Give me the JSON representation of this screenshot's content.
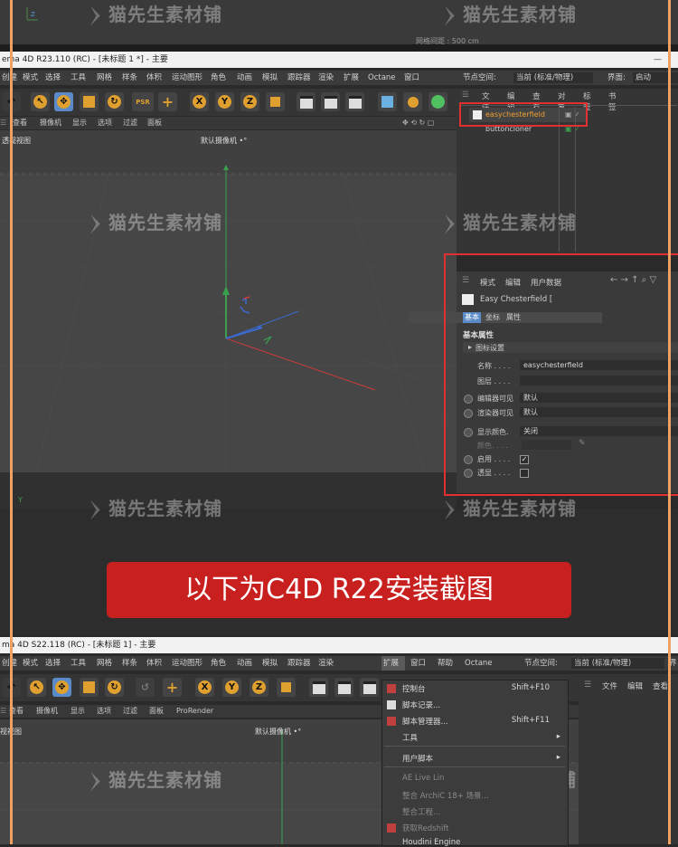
{
  "top_section": {
    "grid_label": "网格间距 : 500 cm"
  },
  "r23": {
    "title": "ema 4D R23.110 (RC) - [未标题 1 *] - 主要",
    "menu": [
      "创建",
      "模式",
      "选择",
      "工具",
      "网格",
      "样条",
      "体积",
      "运动图形",
      "角色",
      "动画",
      "模拟",
      "跟踪器",
      "渲染",
      "扩展",
      "Octane",
      "窗口"
    ],
    "node_space_label": "节点空间:",
    "node_space_value": "当前 (标准/物理)",
    "interface_label": "界面:",
    "interface_value": "启动",
    "toolbar_xyz": [
      "X",
      "Y",
      "Z"
    ],
    "view_menu": [
      "查看",
      "摄像机",
      "显示",
      "选项",
      "过滤",
      "面板"
    ],
    "viewport_name": "透视视图",
    "camera_label": "默认摄像机 •°",
    "obj_menu": [
      "文件",
      "编辑",
      "查看",
      "对象",
      "标签",
      "书签"
    ],
    "objects": [
      {
        "name": "easychesterfield"
      },
      {
        "name": "buttoncloner"
      }
    ],
    "attr_menu": [
      "模式",
      "编辑",
      "用户数据"
    ],
    "attr_object": "Easy Chesterfield [",
    "attr_tabs": [
      "基本",
      "坐标",
      "属性"
    ],
    "attr_section": "基本属性",
    "attr_group": "图标设置",
    "props": {
      "name_label": "名称 . . . .",
      "name_value": "easychesterfield",
      "layer_label": "图层 . . . .",
      "editor_visible_label": "编辑器可见",
      "editor_visible_value": "默认",
      "render_visible_label": "渲染器可见",
      "render_visible_value": "默认",
      "display_color_label": "显示颜色.",
      "display_color_value": "关闭",
      "color_label": "颜色. . . .",
      "enabled_label": "启用 . . . .",
      "transparent_label": "透显 . . . ."
    },
    "axis_y": "Y"
  },
  "banner": {
    "text": "以下为C4D R22安装截图"
  },
  "r22": {
    "title": "ma 4D S22.118 (RC) - [未标题 1] - 主要",
    "menu": [
      "创建",
      "模式",
      "选择",
      "工具",
      "网格",
      "样条",
      "体积",
      "运动图形",
      "角色",
      "动画",
      "模拟",
      "跟踪器",
      "渲染",
      "扩展",
      "窗口",
      "帮助",
      "Octane"
    ],
    "node_space_label": "节点空间:",
    "node_space_value": "当前 (标准/物理)",
    "extra": "界",
    "view_menu": [
      "查看",
      "摄像机",
      "显示",
      "选项",
      "过滤",
      "面板",
      "ProRender"
    ],
    "viewport_name": "视视图",
    "camera_label": "默认摄像机 •°",
    "obj_menu": [
      "文件",
      "编辑",
      "查看"
    ],
    "dropdown": [
      {
        "label": "控制台",
        "shortcut": "Shift+F10"
      },
      {
        "label": "脚本记录..."
      },
      {
        "label": "脚本管理器...",
        "shortcut": "Shift+F11"
      },
      {
        "label": "工具",
        "submenu": true
      },
      {
        "label": "用户脚本",
        "submenu": true
      },
      {
        "label": "AE Live Lin"
      },
      {
        "label": "整合 ArchiC 18+ 场景..."
      },
      {
        "label": "整合工程..."
      },
      {
        "label": "获取Redshift"
      },
      {
        "label": "Houdini Engine"
      }
    ]
  },
  "watermark": "猫先生素材铺",
  "colors": {
    "accent_orange": "#f0a060",
    "highlight_red": "#e03030",
    "banner_red": "#c8201f",
    "select_blue": "#5a8ac8"
  }
}
